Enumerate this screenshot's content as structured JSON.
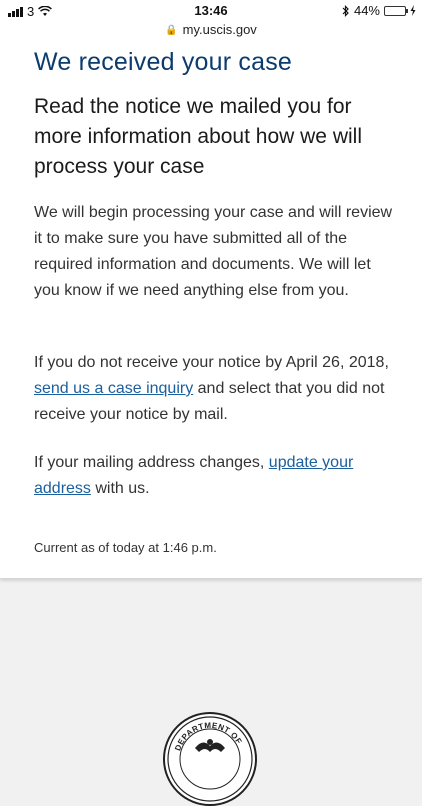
{
  "status_bar": {
    "carrier": "3",
    "time": "13:46",
    "battery_percent": "44%",
    "battery_level": 0.44
  },
  "url_bar": {
    "domain": "my.uscis.gov"
  },
  "case_status": {
    "title": "We received your case",
    "subtitle": "Read the notice we mailed you for more information about how we will process your case",
    "paragraph_1": "We will begin processing your case and will review it to make sure you have submitted all of the required information and documents. We will let you know if we need anything else from you.",
    "paragraph_2_before": "If you do not receive your notice by April 26, 2018, ",
    "paragraph_2_link": "send us a case inquiry",
    "paragraph_2_after": " and select that you did not receive your notice by mail.",
    "paragraph_3_before": "If your mailing address changes, ",
    "paragraph_3_link": "update your address",
    "paragraph_3_after": " with us.",
    "timestamp": "Current as of today at 1:46 p.m."
  },
  "colors": {
    "title": "#0b3c6d",
    "link": "#1a5f9e",
    "page_bg": "#f1f1f1",
    "battery_fill": "#4cd964"
  },
  "seal": {
    "text": "DEPARTMENT OF"
  }
}
